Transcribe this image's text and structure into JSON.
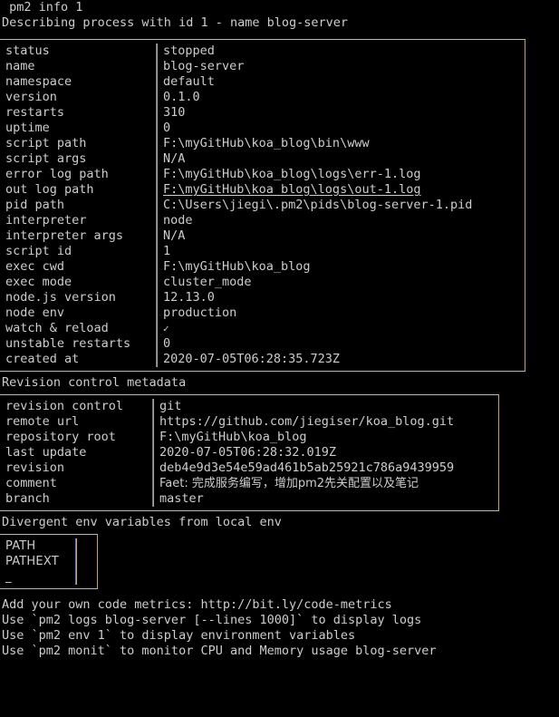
{
  "terminal": {
    "command_line": " pm2 info 1",
    "describe_line": "Describing process with id 1 - name blog-server",
    "colors": {
      "background": "#000000",
      "foreground": "#cdcdcd",
      "box_border_top": "#b9b9b9",
      "box_divider_blue": "#5b7fbd",
      "box_divider_tan": "#c8a165"
    }
  },
  "process_table": {
    "rows": [
      {
        "key": "status",
        "value": "stopped"
      },
      {
        "key": "name",
        "value": "blog-server"
      },
      {
        "key": "namespace",
        "value": "default"
      },
      {
        "key": "version",
        "value": "0.1.0"
      },
      {
        "key": "restarts",
        "value": "310"
      },
      {
        "key": "uptime",
        "value": "0"
      },
      {
        "key": "script path",
        "value": "F:\\myGitHub\\koa_blog\\bin\\www"
      },
      {
        "key": "script args",
        "value": "N/A"
      },
      {
        "key": "error log path",
        "value": "F:\\myGitHub\\koa_blog\\logs\\err-1.log"
      },
      {
        "key": "out log path",
        "value": "F:\\myGitHub\\koa_blog\\logs\\out-1.log"
      },
      {
        "key": "pid path",
        "value": "C:\\Users\\jiegi\\.pm2\\pids\\blog-server-1.pid"
      },
      {
        "key": "interpreter",
        "value": "node"
      },
      {
        "key": "interpreter args",
        "value": "N/A"
      },
      {
        "key": "script id",
        "value": "1"
      },
      {
        "key": "exec cwd",
        "value": "F:\\myGitHub\\koa_blog"
      },
      {
        "key": "exec mode",
        "value": "cluster_mode"
      },
      {
        "key": "node.js version",
        "value": "12.13.0"
      },
      {
        "key": "node env",
        "value": "production"
      },
      {
        "key": "watch & reload",
        "value": "✓"
      },
      {
        "key": "unstable restarts",
        "value": "0"
      },
      {
        "key": "created at",
        "value": "2020-07-05T06:28:35.723Z"
      }
    ]
  },
  "revision_section": {
    "heading": "Revision control metadata",
    "rows": [
      {
        "key": "revision control",
        "value": "git"
      },
      {
        "key": "remote url",
        "value": "https://github.com/jiegiser/koa_blog.git"
      },
      {
        "key": "repository root",
        "value": "F:\\myGitHub\\koa_blog"
      },
      {
        "key": "last update",
        "value": "2020-07-05T06:28:32.019Z"
      },
      {
        "key": "revision",
        "value": "deb4e9d3e54e59ad461b5ab25921c786a9439959"
      },
      {
        "key": "comment",
        "value": "Faet: 完成服务编写，增加pm2先关配置以及笔记"
      },
      {
        "key": "branch",
        "value": "master"
      }
    ]
  },
  "env_section": {
    "heading": "Divergent env variables from local env",
    "rows": [
      {
        "key": "PATH",
        "value": ""
      },
      {
        "key": "PATHEXT",
        "value": ""
      },
      {
        "key": "_",
        "value": ""
      }
    ]
  },
  "footer": {
    "lines": [
      "Add your own code metrics: http://bit.ly/code-metrics",
      "Use `pm2 logs blog-server [--lines 1000]` to display logs",
      "Use `pm2 env 1` to display environment variables",
      "Use `pm2 monit` to monitor CPU and Memory usage blog-server"
    ]
  }
}
